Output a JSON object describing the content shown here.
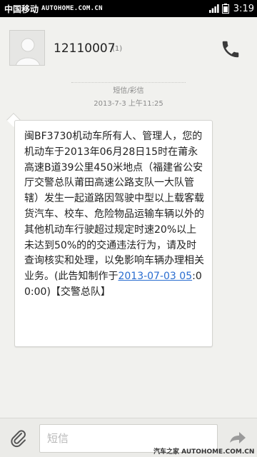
{
  "status_bar": {
    "carrier": "中国移动",
    "watermark": "AUTOHOME.COM.CN",
    "time": "3:19"
  },
  "contact": {
    "number": "12110007",
    "message_count": "(1)"
  },
  "thread": {
    "message_type": "短信/彩信",
    "timestamp": "2013-7-3 上午11:25"
  },
  "message": {
    "body_before_link": "闽BF3730机动车所有人、管理人，您的机动车于2013年06月28日15时在莆永高速B道39公里450米地点（福建省公安厅交警总队莆田高速公路支队一大队管辖）发生一起道路因驾驶中型以上载客载货汽车、校车、危险物品运输车辆以外的其他机动车行驶超过规定时速20%以上未达到50%的的交通违法行为，请及时查询核实和处理，以免影响车辆办理相关业务。(此告知制作于",
    "link_text": "2013-07-03 05",
    "body_after_link": ":00:00)【交警总队】"
  },
  "composer": {
    "placeholder": "短信"
  },
  "footer": {
    "watermark": "汽车之家 AUTOHOME.COM.CN"
  },
  "icons": {
    "call": "phone-icon",
    "attach": "paperclip-icon",
    "send": "send-arrow-icon"
  },
  "colors": {
    "link": "#2a6dd0",
    "status_bar": "#000000",
    "background": "#f1f1ee"
  }
}
